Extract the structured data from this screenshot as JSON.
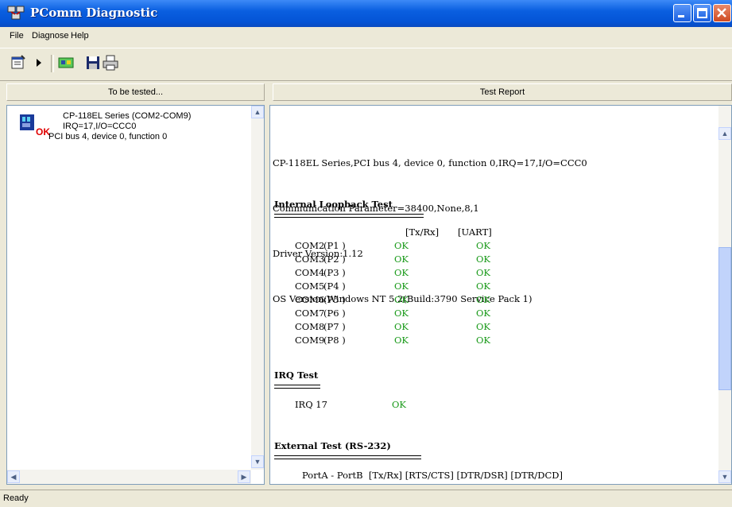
{
  "window": {
    "title": "PComm Diagnostic"
  },
  "menu": {
    "items": [
      "File",
      "Diagnose",
      "Help"
    ]
  },
  "toolbar": {
    "icons": [
      "properties-icon",
      "run-icon",
      "network-icon",
      "save-icon",
      "print-icon"
    ]
  },
  "left_panel": {
    "header": "To be tested...",
    "device": {
      "line1": "CP-118EL Series (COM2-COM9)",
      "line2": "IRQ=17,I/O=CCC0",
      "line3": "PCI bus 4, device 0, function 0",
      "status": "OK"
    }
  },
  "right_panel": {
    "header": "Test Report",
    "summary": [
      "CP-118EL Series,PCI bus 4, device 0, function 0,IRQ=17,I/O=CCC0",
      "Communication Parameter=38400,None,8,1",
      "Driver Version:1.12",
      "OS Version:Windows NT 5.2(Build:3790 Service Pack 1)"
    ],
    "loopback": {
      "title": "Internal Loopback Test",
      "col_txrx": "[Tx/Rx]",
      "col_uart": "[UART]",
      "rows": [
        {
          "com": "COM2",
          "port": "(P1 )",
          "txrx": "OK",
          "uart": "OK"
        },
        {
          "com": "COM3",
          "port": "(P2 )",
          "txrx": "OK",
          "uart": "OK"
        },
        {
          "com": "COM4",
          "port": "(P3 )",
          "txrx": "OK",
          "uart": "OK"
        },
        {
          "com": "COM5",
          "port": "(P4 )",
          "txrx": "OK",
          "uart": "OK"
        },
        {
          "com": "COM6",
          "port": "(P5 )",
          "txrx": "OK",
          "uart": "OK"
        },
        {
          "com": "COM7",
          "port": "(P6 )",
          "txrx": "OK",
          "uart": "OK"
        },
        {
          "com": "COM8",
          "port": "(P7 )",
          "txrx": "OK",
          "uart": "OK"
        },
        {
          "com": "COM9",
          "port": "(P8 )",
          "txrx": "OK",
          "uart": "OK"
        }
      ]
    },
    "irq": {
      "title": "IRQ Test",
      "label": "IRQ 17",
      "result": "OK"
    },
    "external": {
      "title": "External Test (RS-232)",
      "header_line": "PortA - PortB  [Tx/Rx] [RTS/CTS] [DTR/DSR] [DTR/DCD]"
    }
  },
  "status_bar": {
    "text": "Ready"
  },
  "colors": {
    "titlebar": "#0a5fe0",
    "ok_text": "#1a9a1a",
    "window_bg": "#ece9d8"
  }
}
